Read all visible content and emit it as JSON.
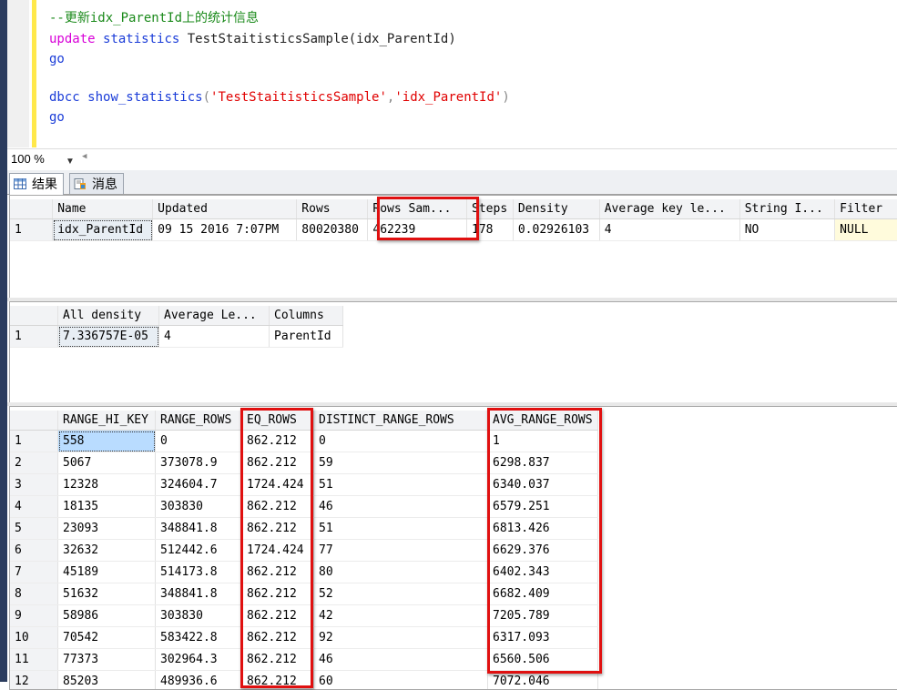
{
  "editor": {
    "lines": [
      {
        "comment": "--更新idx_ParentId上的统计信息"
      },
      {
        "kw": "update",
        "kw2": "statistics",
        "rest": "TestStaitisticsSample(idx_ParentId)"
      },
      {
        "go": "go"
      },
      {
        "dbcc": "dbcc",
        "func": "show_statistics",
        "open": "(",
        "arg1": "'TestStaitisticsSample'",
        "comma": ",",
        "arg2": "'idx_ParentId'",
        "close": ")"
      },
      {
        "go": "go"
      }
    ]
  },
  "zoom": {
    "value": "100 %"
  },
  "tabs": [
    {
      "label": "结果",
      "icon": "grid-icon"
    },
    {
      "label": "消息",
      "icon": "messages-icon"
    }
  ],
  "header_grid": {
    "columns": [
      "Name",
      "Updated",
      "Rows",
      "Rows Sam...",
      "Steps",
      "Density",
      "Average key le...",
      "String I...",
      "Filter"
    ],
    "rows": [
      {
        "n": "1",
        "cells": [
          "idx_ParentId",
          "09 15 2016  7:07PM",
          "80020380",
          "462239",
          "178",
          "0.02926103",
          "4",
          "NO",
          "NULL"
        ]
      }
    ]
  },
  "density_grid": {
    "columns": [
      "All density",
      "Average Le...",
      "Columns"
    ],
    "rows": [
      {
        "n": "1",
        "cells": [
          "7.336757E-05",
          "4",
          "ParentId"
        ]
      }
    ]
  },
  "histogram_grid": {
    "columns": [
      "RANGE_HI_KEY",
      "RANGE_ROWS",
      "EQ_ROWS",
      "DISTINCT_RANGE_ROWS",
      "AVG_RANGE_ROWS"
    ],
    "rows": [
      {
        "n": "1",
        "cells": [
          "558",
          "0",
          "862.212",
          "0",
          "1"
        ]
      },
      {
        "n": "2",
        "cells": [
          "5067",
          "373078.9",
          "862.212",
          "59",
          "6298.837"
        ]
      },
      {
        "n": "3",
        "cells": [
          "12328",
          "324604.7",
          "1724.424",
          "51",
          "6340.037"
        ]
      },
      {
        "n": "4",
        "cells": [
          "18135",
          "303830",
          "862.212",
          "46",
          "6579.251"
        ]
      },
      {
        "n": "5",
        "cells": [
          "23093",
          "348841.8",
          "862.212",
          "51",
          "6813.426"
        ]
      },
      {
        "n": "6",
        "cells": [
          "32632",
          "512442.6",
          "1724.424",
          "77",
          "6629.376"
        ]
      },
      {
        "n": "7",
        "cells": [
          "45189",
          "514173.8",
          "862.212",
          "80",
          "6402.343"
        ]
      },
      {
        "n": "8",
        "cells": [
          "51632",
          "348841.8",
          "862.212",
          "52",
          "6682.409"
        ]
      },
      {
        "n": "9",
        "cells": [
          "58986",
          "303830",
          "862.212",
          "42",
          "7205.789"
        ]
      },
      {
        "n": "10",
        "cells": [
          "70542",
          "583422.8",
          "862.212",
          "92",
          "6317.093"
        ]
      },
      {
        "n": "11",
        "cells": [
          "77373",
          "302964.3",
          "862.212",
          "46",
          "6560.506"
        ]
      },
      {
        "n": "12",
        "cells": [
          "85203",
          "489936.6",
          "862.212",
          "60",
          "7072.046"
        ]
      }
    ]
  },
  "highlight_color": "#e01010"
}
